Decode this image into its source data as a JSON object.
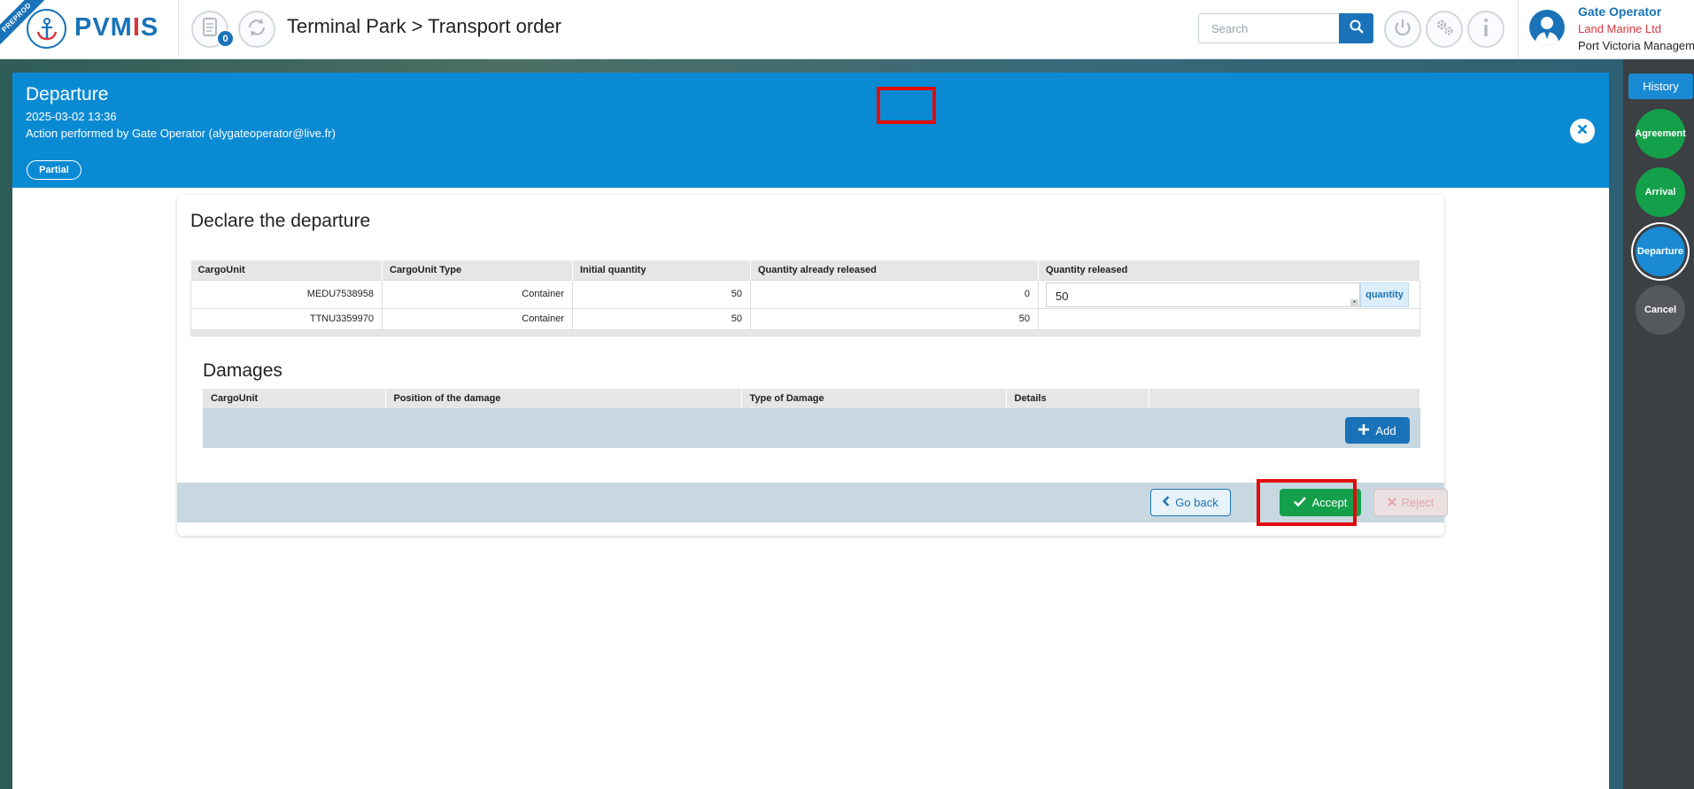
{
  "header": {
    "env_ribbon": "PREPROD",
    "logo_main": "PVM",
    "logo_accent": "I",
    "logo_tail": "S",
    "notifications_count": "0",
    "title": "Terminal Park > Transport order",
    "search_placeholder": "Search",
    "user": {
      "name": "Gate Operator",
      "company": "Land Marine Ltd",
      "organization": "Port Victoria Management"
    }
  },
  "side_panel": {
    "history_label": "History",
    "steps": [
      {
        "label": "Agreement",
        "status": "done"
      },
      {
        "label": "Arrival",
        "status": "done"
      },
      {
        "label": "Departure",
        "status": "current"
      },
      {
        "label": "Cancel",
        "status": "inactive"
      }
    ]
  },
  "modal": {
    "title": "Departure",
    "date": "2025-03-02 13:36",
    "action_text": "Action performed by Gate Operator (alygateoperator@live.fr)",
    "status_pill": "Partial"
  },
  "declare": {
    "title": "Declare the departure",
    "columns": [
      "CargoUnit",
      "CargoUnit Type",
      "Initial quantity",
      "Quantity already released",
      "Quantity released"
    ],
    "rows": [
      {
        "cargo_unit": "MEDU7538958",
        "type": "Container",
        "initial": "50",
        "already_released": "0",
        "released_value": "50",
        "released_addon": "quantity"
      },
      {
        "cargo_unit": "TTNU3359970",
        "type": "Container",
        "initial": "50",
        "already_released": "50"
      }
    ],
    "required_marker": "*"
  },
  "damages": {
    "title": "Damages",
    "columns": [
      "CargoUnit",
      "Position of the damage",
      "Type of Damage",
      "Details"
    ],
    "add_label": "Add"
  },
  "actions": {
    "go_back": "Go back",
    "accept": "Accept",
    "reject": "Reject"
  },
  "colors": {
    "brand_blue": "#1a73b8",
    "header_blue": "#0b8ad4",
    "accept_green": "#14a04a",
    "highlight_red": "#e10c0c",
    "accent_red": "#d9363e"
  }
}
